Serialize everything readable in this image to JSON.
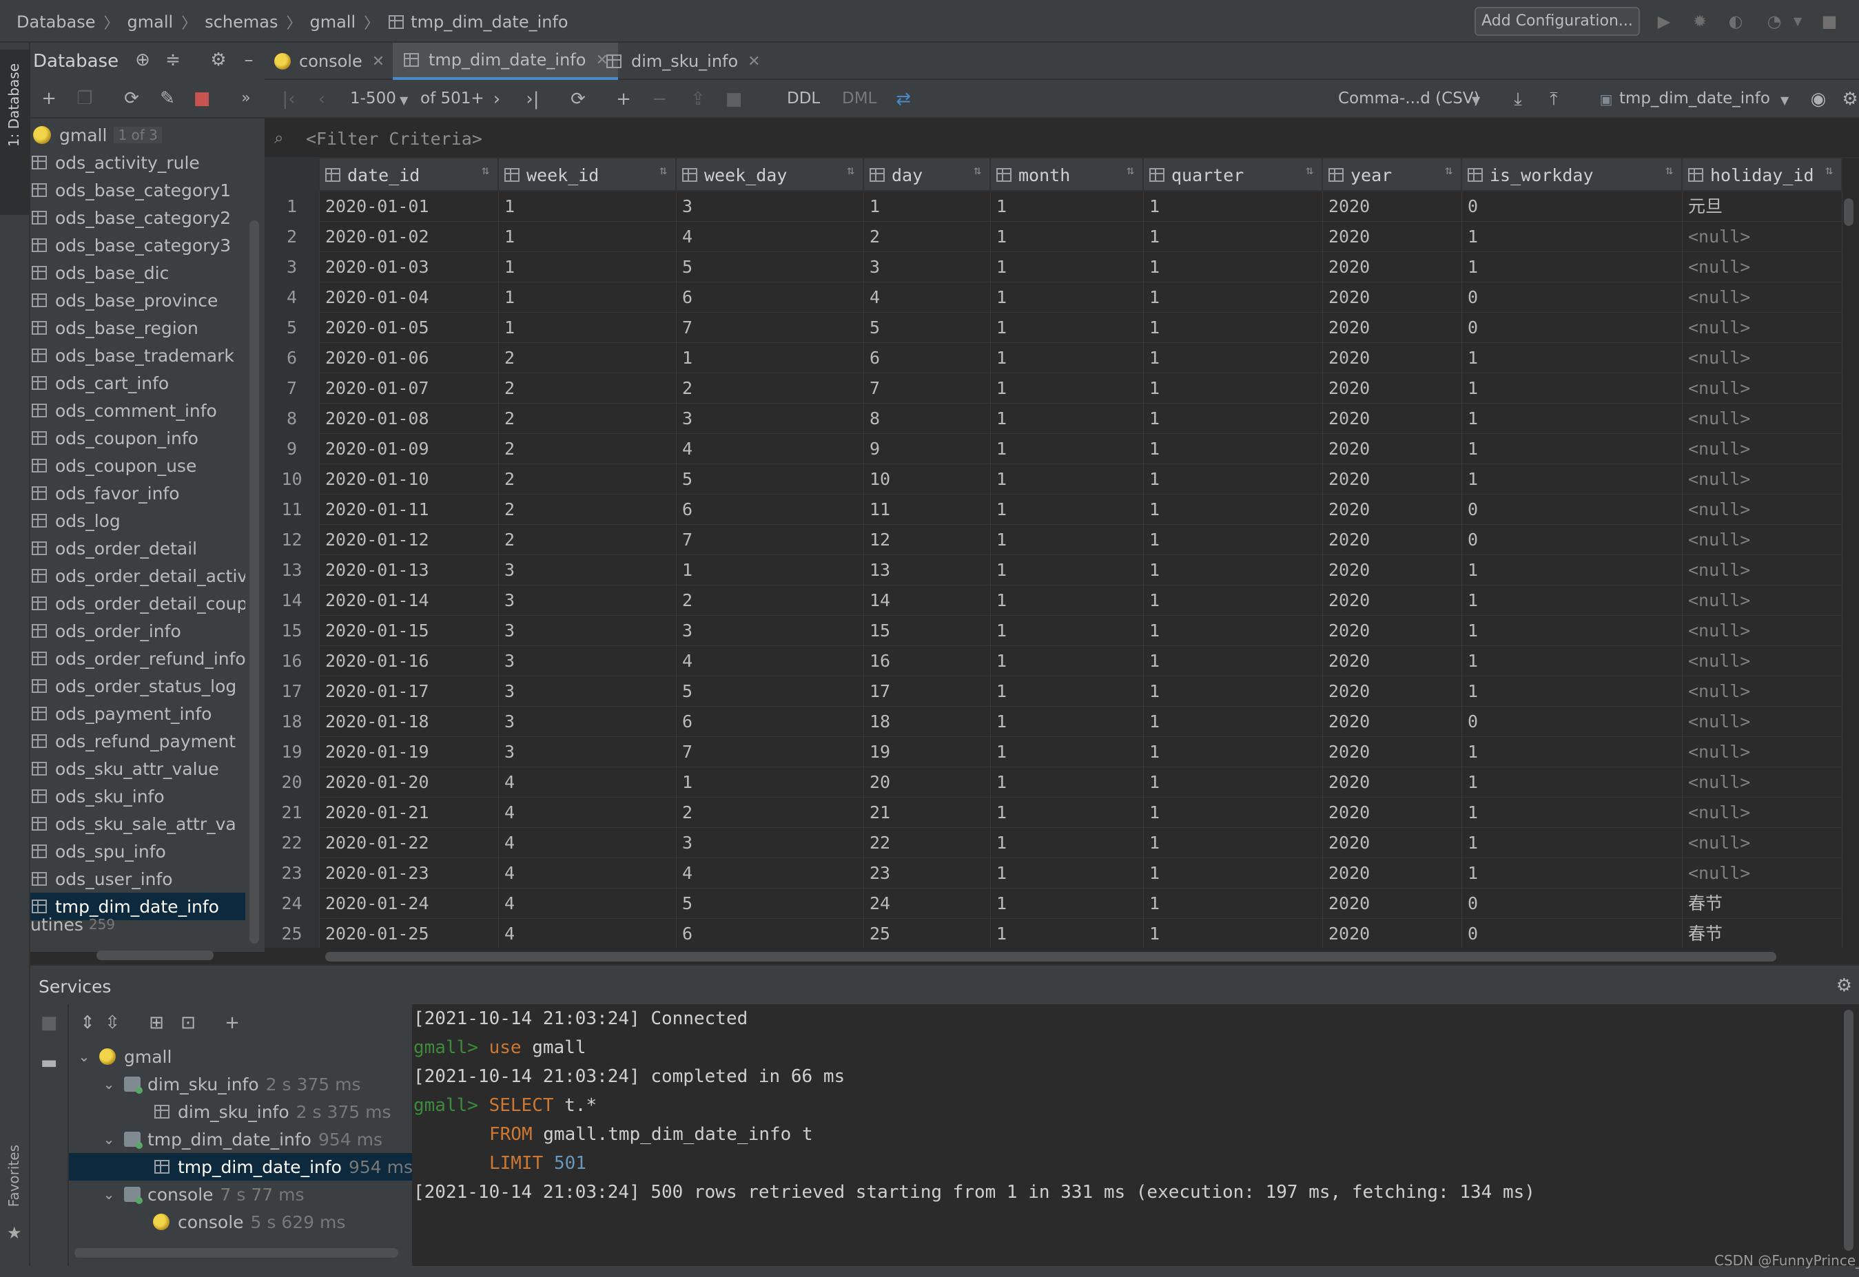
{
  "breadcrumb": [
    "Database",
    "gmall",
    "schemas",
    "gmall",
    "tmp_dim_date_info"
  ],
  "navbar": {
    "add_config": "Add Configuration..."
  },
  "left_strip": {
    "database_tab": "1: Database",
    "favorites_tab": "Favorites"
  },
  "db_panel": {
    "title": "Database",
    "schema": {
      "name": "gmall",
      "badge": "1 of 3"
    },
    "tables": [
      "ods_activity_rule",
      "ods_base_category1",
      "ods_base_category2",
      "ods_base_category3",
      "ods_base_dic",
      "ods_base_province",
      "ods_base_region",
      "ods_base_trademark",
      "ods_cart_info",
      "ods_comment_info",
      "ods_coupon_info",
      "ods_coupon_use",
      "ods_favor_info",
      "ods_log",
      "ods_order_detail",
      "ods_order_detail_activi",
      "ods_order_detail_coupo",
      "ods_order_info",
      "ods_order_refund_info",
      "ods_order_status_log",
      "ods_payment_info",
      "ods_refund_payment",
      "ods_sku_attr_value",
      "ods_sku_info",
      "ods_sku_sale_attr_va",
      "ods_spu_info",
      "ods_user_info",
      "tmp_dim_date_info"
    ],
    "selected_table": "tmp_dim_date_info",
    "routines": {
      "label": "utines",
      "count": "259"
    }
  },
  "tabs": [
    {
      "label": "console"
    },
    {
      "label": "tmp_dim_date_info"
    },
    {
      "label": "dim_sku_info"
    }
  ],
  "grid_toolbar": {
    "page_range": "1-500",
    "of_count": "of 501+",
    "ddl": "DDL",
    "dml": "DML",
    "export_format": "Comma-...d (CSV)",
    "table_selector": "tmp_dim_date_info"
  },
  "filter": {
    "placeholder": "<Filter Criteria>"
  },
  "grid": {
    "columns": [
      "date_id",
      "week_id",
      "week_day",
      "day",
      "month",
      "quarter",
      "year",
      "is_workday",
      "holiday_id"
    ],
    "rows": [
      [
        "1",
        "2020-01-01",
        "1",
        "3",
        "1",
        "1",
        "1",
        "2020",
        "0",
        "元旦"
      ],
      [
        "2",
        "2020-01-02",
        "1",
        "4",
        "2",
        "1",
        "1",
        "2020",
        "1",
        "<null>"
      ],
      [
        "3",
        "2020-01-03",
        "1",
        "5",
        "3",
        "1",
        "1",
        "2020",
        "1",
        "<null>"
      ],
      [
        "4",
        "2020-01-04",
        "1",
        "6",
        "4",
        "1",
        "1",
        "2020",
        "0",
        "<null>"
      ],
      [
        "5",
        "2020-01-05",
        "1",
        "7",
        "5",
        "1",
        "1",
        "2020",
        "0",
        "<null>"
      ],
      [
        "6",
        "2020-01-06",
        "2",
        "1",
        "6",
        "1",
        "1",
        "2020",
        "1",
        "<null>"
      ],
      [
        "7",
        "2020-01-07",
        "2",
        "2",
        "7",
        "1",
        "1",
        "2020",
        "1",
        "<null>"
      ],
      [
        "8",
        "2020-01-08",
        "2",
        "3",
        "8",
        "1",
        "1",
        "2020",
        "1",
        "<null>"
      ],
      [
        "9",
        "2020-01-09",
        "2",
        "4",
        "9",
        "1",
        "1",
        "2020",
        "1",
        "<null>"
      ],
      [
        "10",
        "2020-01-10",
        "2",
        "5",
        "10",
        "1",
        "1",
        "2020",
        "1",
        "<null>"
      ],
      [
        "11",
        "2020-01-11",
        "2",
        "6",
        "11",
        "1",
        "1",
        "2020",
        "0",
        "<null>"
      ],
      [
        "12",
        "2020-01-12",
        "2",
        "7",
        "12",
        "1",
        "1",
        "2020",
        "0",
        "<null>"
      ],
      [
        "13",
        "2020-01-13",
        "3",
        "1",
        "13",
        "1",
        "1",
        "2020",
        "1",
        "<null>"
      ],
      [
        "14",
        "2020-01-14",
        "3",
        "2",
        "14",
        "1",
        "1",
        "2020",
        "1",
        "<null>"
      ],
      [
        "15",
        "2020-01-15",
        "3",
        "3",
        "15",
        "1",
        "1",
        "2020",
        "1",
        "<null>"
      ],
      [
        "16",
        "2020-01-16",
        "3",
        "4",
        "16",
        "1",
        "1",
        "2020",
        "1",
        "<null>"
      ],
      [
        "17",
        "2020-01-17",
        "3",
        "5",
        "17",
        "1",
        "1",
        "2020",
        "1",
        "<null>"
      ],
      [
        "18",
        "2020-01-18",
        "3",
        "6",
        "18",
        "1",
        "1",
        "2020",
        "0",
        "<null>"
      ],
      [
        "19",
        "2020-01-19",
        "3",
        "7",
        "19",
        "1",
        "1",
        "2020",
        "1",
        "<null>"
      ],
      [
        "20",
        "2020-01-20",
        "4",
        "1",
        "20",
        "1",
        "1",
        "2020",
        "1",
        "<null>"
      ],
      [
        "21",
        "2020-01-21",
        "4",
        "2",
        "21",
        "1",
        "1",
        "2020",
        "1",
        "<null>"
      ],
      [
        "22",
        "2020-01-22",
        "4",
        "3",
        "22",
        "1",
        "1",
        "2020",
        "1",
        "<null>"
      ],
      [
        "23",
        "2020-01-23",
        "4",
        "4",
        "23",
        "1",
        "1",
        "2020",
        "1",
        "<null>"
      ],
      [
        "24",
        "2020-01-24",
        "4",
        "5",
        "24",
        "1",
        "1",
        "2020",
        "0",
        "春节"
      ],
      [
        "25",
        "2020-01-25",
        "4",
        "6",
        "25",
        "1",
        "1",
        "2020",
        "0",
        "春节"
      ]
    ]
  },
  "services": {
    "title": "Services",
    "tree": [
      {
        "label": "gmall",
        "time": ""
      },
      {
        "label": "dim_sku_info",
        "time": "2 s 375 ms"
      },
      {
        "label": "dim_sku_info",
        "time": "2 s 375 ms"
      },
      {
        "label": "tmp_dim_date_info",
        "time": "954 ms"
      },
      {
        "label": "tmp_dim_date_info",
        "time": "954 ms"
      },
      {
        "label": "console",
        "time": "7 s 77 ms"
      },
      {
        "label": "console",
        "time": "5 s 629 ms"
      }
    ]
  },
  "console": {
    "line1": "[2021-10-14 21:03:24] Connected",
    "prompt": "gmall>",
    "use_kw": "use",
    "use_arg": "gmall",
    "line3": "[2021-10-14 21:03:24] completed in 66 ms",
    "select_kw": "SELECT",
    "select_arg": "t.*",
    "from_kw": "FROM",
    "from_arg": "gmall.tmp_dim_date_info t",
    "limit_kw": "LIMIT",
    "limit_num": "501",
    "line7": "[2021-10-14 21:03:24] 500 rows retrieved starting from 1 in 331 ms (execution: 197 ms, fetching: 134 ms)"
  },
  "watermark": "CSDN @FunnyPrince_"
}
